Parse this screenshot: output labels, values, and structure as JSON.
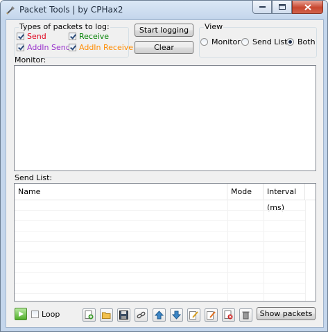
{
  "window": {
    "title": "Packet Tools | by CPHax2"
  },
  "log_types": {
    "group_label": "Types of packets to log:",
    "items": [
      {
        "label": "Send",
        "checked": true,
        "color": "#e0001b"
      },
      {
        "label": "Receive",
        "checked": true,
        "color": "#008000"
      },
      {
        "label": "AddIn Send",
        "checked": true,
        "color": "#9932cc"
      },
      {
        "label": "AddIn Receive",
        "checked": true,
        "color": "#ff8c00"
      }
    ]
  },
  "buttons": {
    "start_logging": "Start logging",
    "clear": "Clear",
    "show_packets": "Show packets"
  },
  "view": {
    "group_label": "View",
    "options": [
      "Monitor",
      "Send List",
      "Both"
    ],
    "selected": "Both"
  },
  "monitor": {
    "label": "Monitor:"
  },
  "send_list": {
    "label": "Send List:",
    "columns": [
      "Name",
      "Mode",
      "Interval (ms)"
    ]
  },
  "footer": {
    "loop_label": "Loop",
    "loop_checked": false,
    "tools": [
      "add-packet-icon",
      "open-folder-icon",
      "save-icon",
      "link-icon",
      "move-up-icon",
      "move-down-icon",
      "edit-icon",
      "edit-alt-icon",
      "delete-icon",
      "trash-icon"
    ]
  }
}
